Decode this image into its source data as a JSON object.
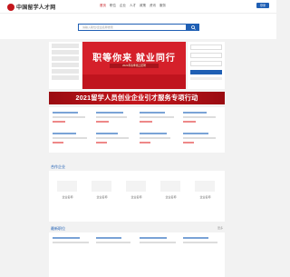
{
  "header": {
    "logo_text": "中国留学人才网",
    "nav": [
      "首页",
      "职位",
      "企业",
      "人才",
      "政策",
      "资讯",
      "服务"
    ],
    "login_label": "登录"
  },
  "search": {
    "placeholder": "请输入职位/企业名称搜索"
  },
  "banner": {
    "headline": "职等你来 就业同行",
    "subline": "2021年春季线上招聘"
  },
  "promo": {
    "text": "2021留学人员创业企业引才服务专项行动"
  },
  "enterprises": {
    "title": "合作企业",
    "names": [
      "企业名称",
      "企业名称",
      "企业名称",
      "企业名称",
      "企业名称"
    ]
  },
  "section2": {
    "title": "最新职位",
    "more": "更多"
  },
  "colors": {
    "brand_red": "#c4161c",
    "brand_blue": "#1f5fb4"
  }
}
